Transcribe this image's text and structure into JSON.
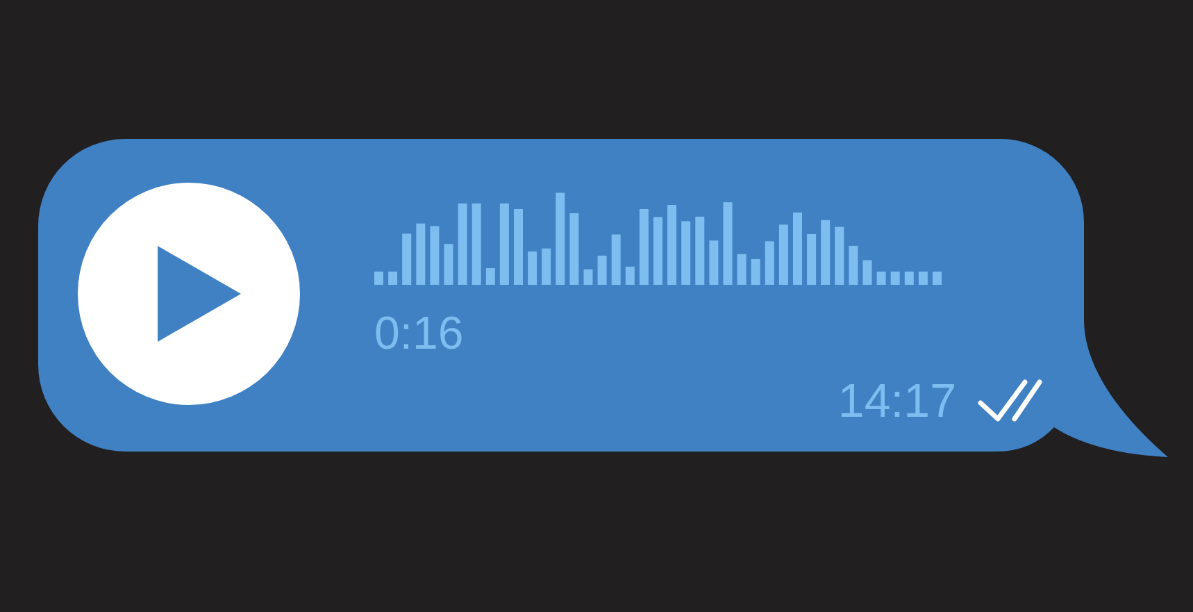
{
  "voice_message": {
    "playing": false,
    "duration": "0:16"
  },
  "meta": {
    "time": "14:17",
    "read": true
  }
}
